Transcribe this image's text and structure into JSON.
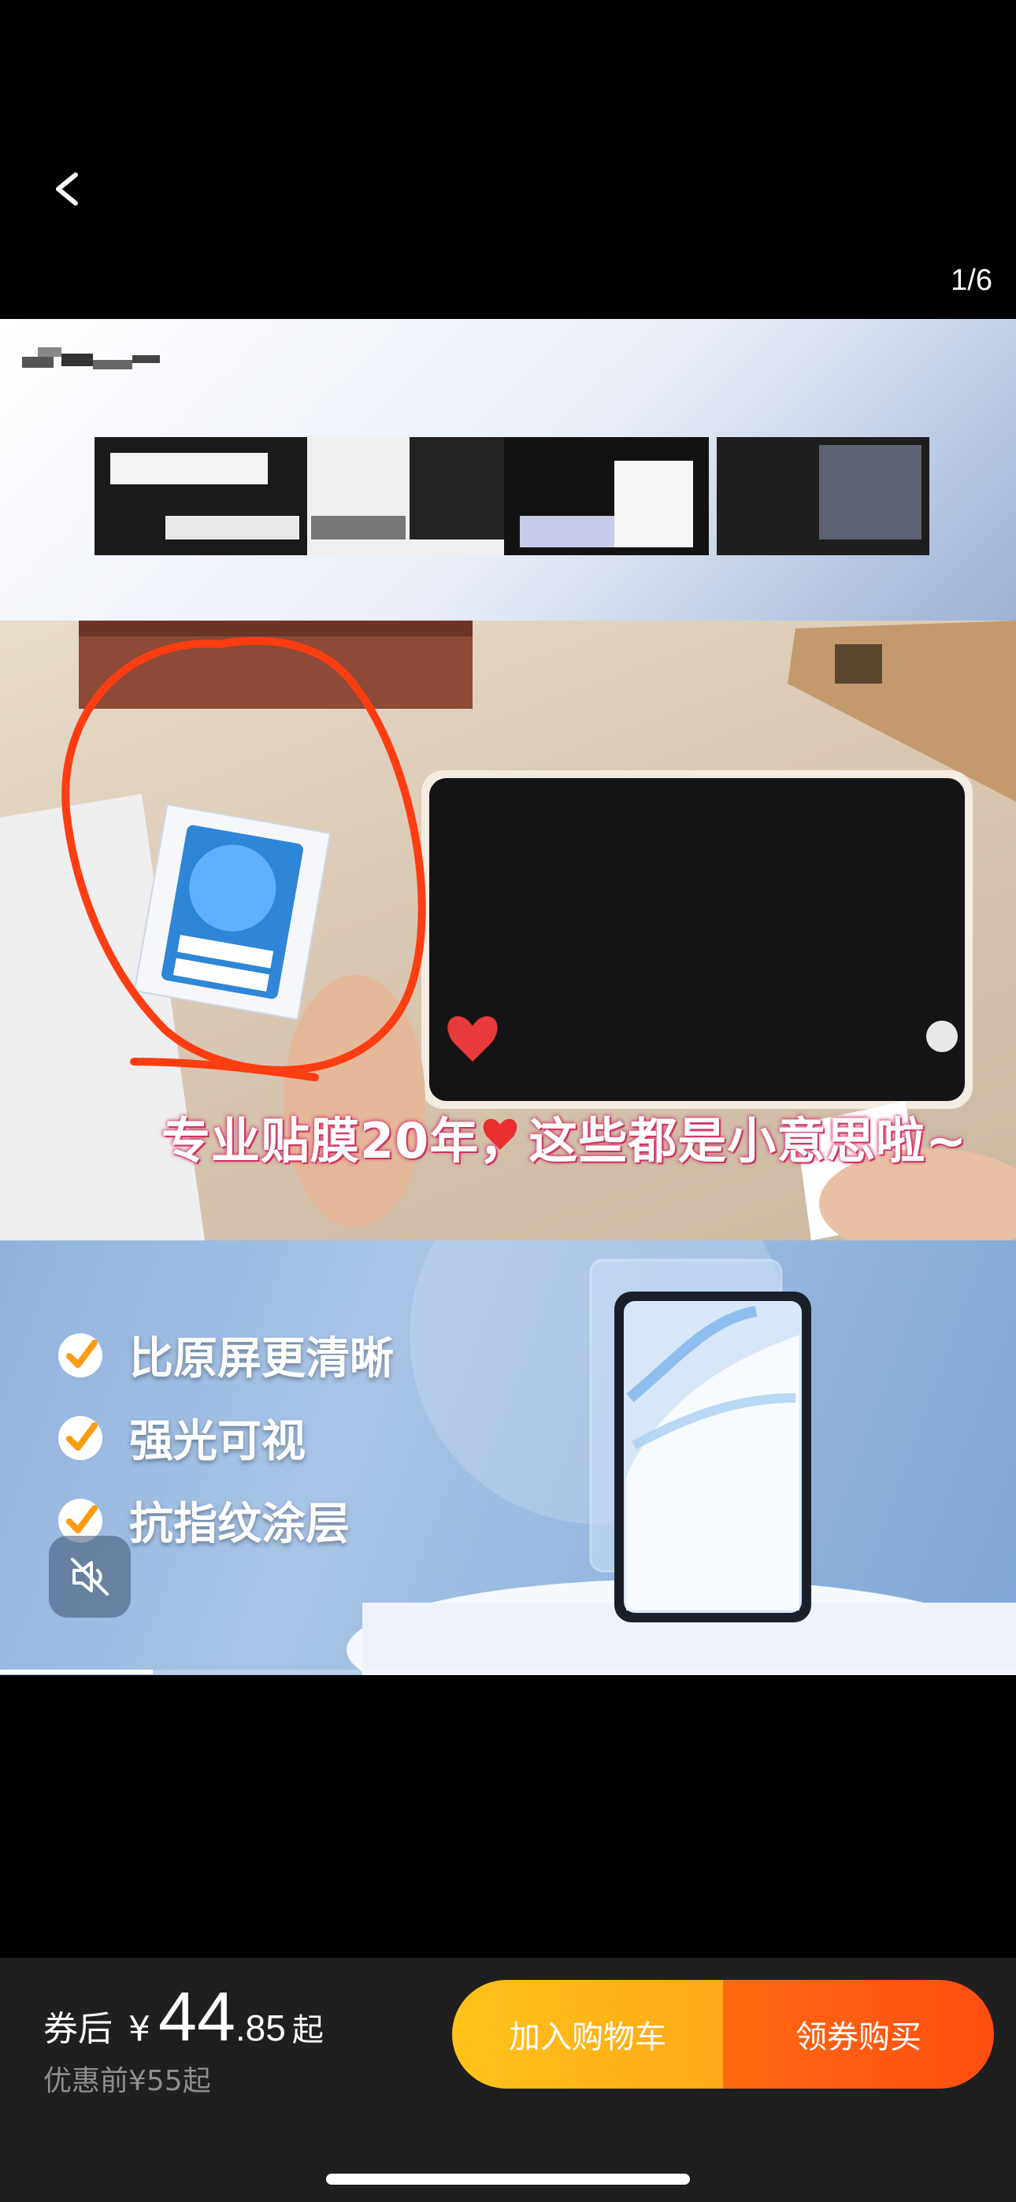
{
  "pager": {
    "text": "1/6"
  },
  "media": {
    "caption": "专业贴膜20年，这些都是小意思啦~",
    "features": [
      "比原屏更清晰",
      "强光可视",
      "抗指纹涂层"
    ],
    "progress": 0.15
  },
  "price": {
    "prefix": "券后",
    "currency": "¥",
    "integer": "44",
    "decimal": ".85",
    "suffix": "起",
    "original": "优惠前¥55起"
  },
  "buttons": {
    "add_to_cart": "加入购物车",
    "buy_with_coupon": "领券购买"
  },
  "colors": {
    "cart_start": "#ffc21a",
    "buy_start": "#ff6a10",
    "annotation": "#ff3d12"
  },
  "icons": {
    "back": "chevron-left-icon",
    "mute": "speaker-muted-icon",
    "check": "check-icon"
  }
}
